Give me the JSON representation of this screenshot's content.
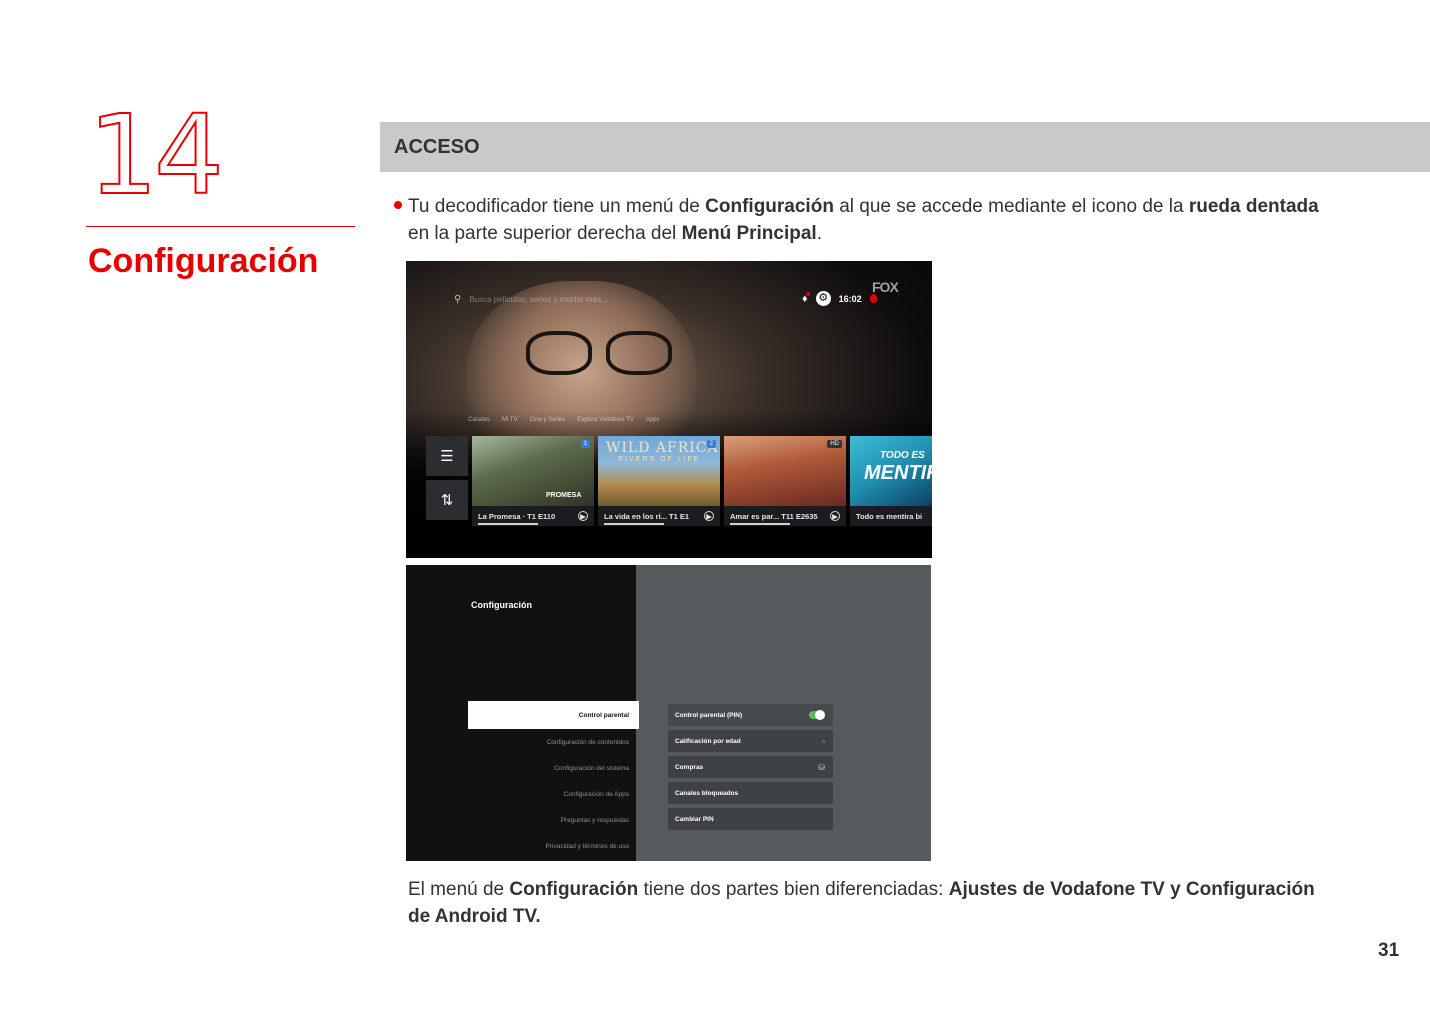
{
  "chapter": {
    "number": "14",
    "title": "Configuración"
  },
  "section": {
    "heading": "ACCESO"
  },
  "intro": {
    "t1": "Tu decodificador tiene un menú de ",
    "b1": "Configuración",
    "t2": " al que se accede mediante el icono de la ",
    "b2": "rueda dentada",
    "t3": " en la parte superior derecha del ",
    "b3": "Menú Principal",
    "t4": "."
  },
  "screen_home": {
    "search_placeholder": "Busca películas, series y mucho más...",
    "time": "16:02",
    "channel_logo": "FOX",
    "tabs": [
      "Canales",
      "Mi TV",
      "Cine y Series",
      "Explora Vodafone TV",
      "Apps"
    ],
    "cards": [
      {
        "title": "La Promesa · T1 E110",
        "badge": "1",
        "overlay": "PROMESA"
      },
      {
        "title": "La vida en los rí... T1 E1",
        "badge": "2",
        "overlay": "WILD AFRICA",
        "overlay_sub": "RIVERS OF LIFE"
      },
      {
        "title": "Amar es par... T11 E2635",
        "badge": "HD"
      },
      {
        "title": "Todo es mentira bi",
        "overlay": "TODO ES",
        "overlay2": "MENTIRA"
      }
    ]
  },
  "screen_settings": {
    "title": "Configuración",
    "menu": [
      "Control parental",
      "Configuración de contenidos",
      "Configuración del sistema",
      "Configuración de Apps",
      "Preguntas y respuestas",
      "Privacidad y términos de uso"
    ],
    "options": [
      {
        "label": "Control parental (PIN)",
        "icon": "toggle-switch"
      },
      {
        "label": "Calificación por edad",
        "icon": "info-icon"
      },
      {
        "label": "Compras",
        "icon": "lock-icon"
      },
      {
        "label": "Canales bloqueados",
        "icon": ""
      },
      {
        "label": "Cambiar PIN",
        "icon": ""
      }
    ]
  },
  "caption": {
    "t1": "El menú de ",
    "b1": "Configuración",
    "t2": " tiene dos partes bien diferenciadas: ",
    "b2": "Ajustes de Vodafone TV y Configuración de Android TV."
  },
  "page_number": "31",
  "colors": {
    "accent": "#e60000",
    "section_bar": "#c8c9cb"
  }
}
